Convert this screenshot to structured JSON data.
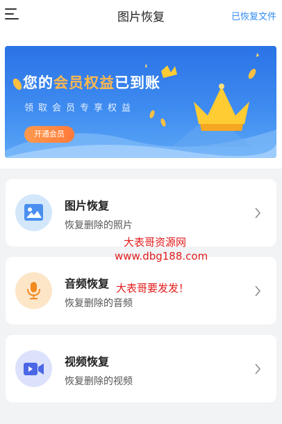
{
  "header": {
    "title": "图片恢复",
    "recovered_link": "已恢复文件"
  },
  "banner": {
    "headline_prefix": "您的",
    "headline_highlight": "会员权益",
    "headline_suffix": "已到账",
    "subtitle": "领取会员专享权益",
    "cta_label": "开通会员"
  },
  "features": [
    {
      "title": "图片恢复",
      "subtitle": "恢复删除的照片",
      "icon": "image-icon",
      "color": "#4a8ff0",
      "bg": "#d3e7fb"
    },
    {
      "title": "音频恢复",
      "subtitle": "恢复删除的音频",
      "icon": "microphone-icon",
      "color": "#f18a1f",
      "bg": "#fde5c8"
    },
    {
      "title": "视频恢复",
      "subtitle": "恢复删除的视频",
      "icon": "video-camera-icon",
      "color": "#4b67e6",
      "bg": "#dce2fb"
    }
  ],
  "watermark": {
    "line1": "大表哥资源网",
    "line2": "www.dbg188.com",
    "line3": "大表哥要发发！"
  }
}
